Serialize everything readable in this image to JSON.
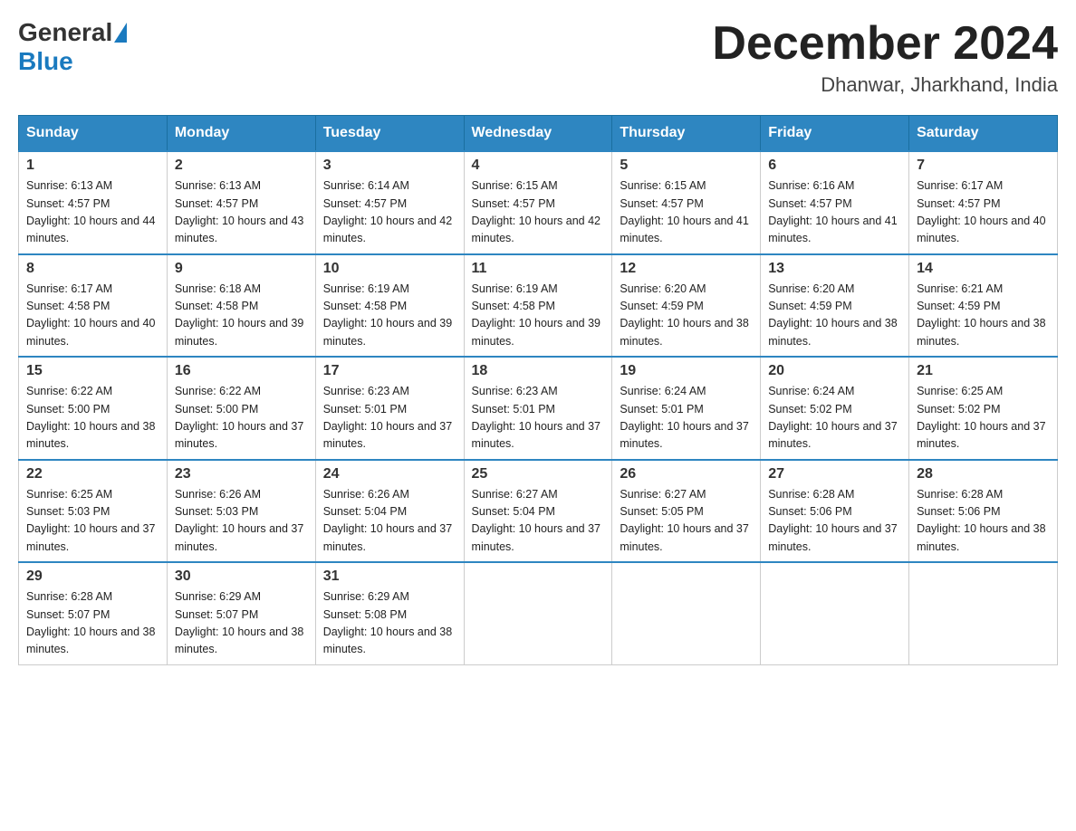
{
  "header": {
    "logo": {
      "general_text": "General",
      "blue_text": "Blue"
    },
    "month_title": "December 2024",
    "location": "Dhanwar, Jharkhand, India"
  },
  "days_of_week": [
    "Sunday",
    "Monday",
    "Tuesday",
    "Wednesday",
    "Thursday",
    "Friday",
    "Saturday"
  ],
  "weeks": [
    [
      {
        "day": "1",
        "sunrise": "6:13 AM",
        "sunset": "4:57 PM",
        "daylight": "10 hours and 44 minutes."
      },
      {
        "day": "2",
        "sunrise": "6:13 AM",
        "sunset": "4:57 PM",
        "daylight": "10 hours and 43 minutes."
      },
      {
        "day": "3",
        "sunrise": "6:14 AM",
        "sunset": "4:57 PM",
        "daylight": "10 hours and 42 minutes."
      },
      {
        "day": "4",
        "sunrise": "6:15 AM",
        "sunset": "4:57 PM",
        "daylight": "10 hours and 42 minutes."
      },
      {
        "day": "5",
        "sunrise": "6:15 AM",
        "sunset": "4:57 PM",
        "daylight": "10 hours and 41 minutes."
      },
      {
        "day": "6",
        "sunrise": "6:16 AM",
        "sunset": "4:57 PM",
        "daylight": "10 hours and 41 minutes."
      },
      {
        "day": "7",
        "sunrise": "6:17 AM",
        "sunset": "4:57 PM",
        "daylight": "10 hours and 40 minutes."
      }
    ],
    [
      {
        "day": "8",
        "sunrise": "6:17 AM",
        "sunset": "4:58 PM",
        "daylight": "10 hours and 40 minutes."
      },
      {
        "day": "9",
        "sunrise": "6:18 AM",
        "sunset": "4:58 PM",
        "daylight": "10 hours and 39 minutes."
      },
      {
        "day": "10",
        "sunrise": "6:19 AM",
        "sunset": "4:58 PM",
        "daylight": "10 hours and 39 minutes."
      },
      {
        "day": "11",
        "sunrise": "6:19 AM",
        "sunset": "4:58 PM",
        "daylight": "10 hours and 39 minutes."
      },
      {
        "day": "12",
        "sunrise": "6:20 AM",
        "sunset": "4:59 PM",
        "daylight": "10 hours and 38 minutes."
      },
      {
        "day": "13",
        "sunrise": "6:20 AM",
        "sunset": "4:59 PM",
        "daylight": "10 hours and 38 minutes."
      },
      {
        "day": "14",
        "sunrise": "6:21 AM",
        "sunset": "4:59 PM",
        "daylight": "10 hours and 38 minutes."
      }
    ],
    [
      {
        "day": "15",
        "sunrise": "6:22 AM",
        "sunset": "5:00 PM",
        "daylight": "10 hours and 38 minutes."
      },
      {
        "day": "16",
        "sunrise": "6:22 AM",
        "sunset": "5:00 PM",
        "daylight": "10 hours and 37 minutes."
      },
      {
        "day": "17",
        "sunrise": "6:23 AM",
        "sunset": "5:01 PM",
        "daylight": "10 hours and 37 minutes."
      },
      {
        "day": "18",
        "sunrise": "6:23 AM",
        "sunset": "5:01 PM",
        "daylight": "10 hours and 37 minutes."
      },
      {
        "day": "19",
        "sunrise": "6:24 AM",
        "sunset": "5:01 PM",
        "daylight": "10 hours and 37 minutes."
      },
      {
        "day": "20",
        "sunrise": "6:24 AM",
        "sunset": "5:02 PM",
        "daylight": "10 hours and 37 minutes."
      },
      {
        "day": "21",
        "sunrise": "6:25 AM",
        "sunset": "5:02 PM",
        "daylight": "10 hours and 37 minutes."
      }
    ],
    [
      {
        "day": "22",
        "sunrise": "6:25 AM",
        "sunset": "5:03 PM",
        "daylight": "10 hours and 37 minutes."
      },
      {
        "day": "23",
        "sunrise": "6:26 AM",
        "sunset": "5:03 PM",
        "daylight": "10 hours and 37 minutes."
      },
      {
        "day": "24",
        "sunrise": "6:26 AM",
        "sunset": "5:04 PM",
        "daylight": "10 hours and 37 minutes."
      },
      {
        "day": "25",
        "sunrise": "6:27 AM",
        "sunset": "5:04 PM",
        "daylight": "10 hours and 37 minutes."
      },
      {
        "day": "26",
        "sunrise": "6:27 AM",
        "sunset": "5:05 PM",
        "daylight": "10 hours and 37 minutes."
      },
      {
        "day": "27",
        "sunrise": "6:28 AM",
        "sunset": "5:06 PM",
        "daylight": "10 hours and 37 minutes."
      },
      {
        "day": "28",
        "sunrise": "6:28 AM",
        "sunset": "5:06 PM",
        "daylight": "10 hours and 38 minutes."
      }
    ],
    [
      {
        "day": "29",
        "sunrise": "6:28 AM",
        "sunset": "5:07 PM",
        "daylight": "10 hours and 38 minutes."
      },
      {
        "day": "30",
        "sunrise": "6:29 AM",
        "sunset": "5:07 PM",
        "daylight": "10 hours and 38 minutes."
      },
      {
        "day": "31",
        "sunrise": "6:29 AM",
        "sunset": "5:08 PM",
        "daylight": "10 hours and 38 minutes."
      },
      null,
      null,
      null,
      null
    ]
  ]
}
